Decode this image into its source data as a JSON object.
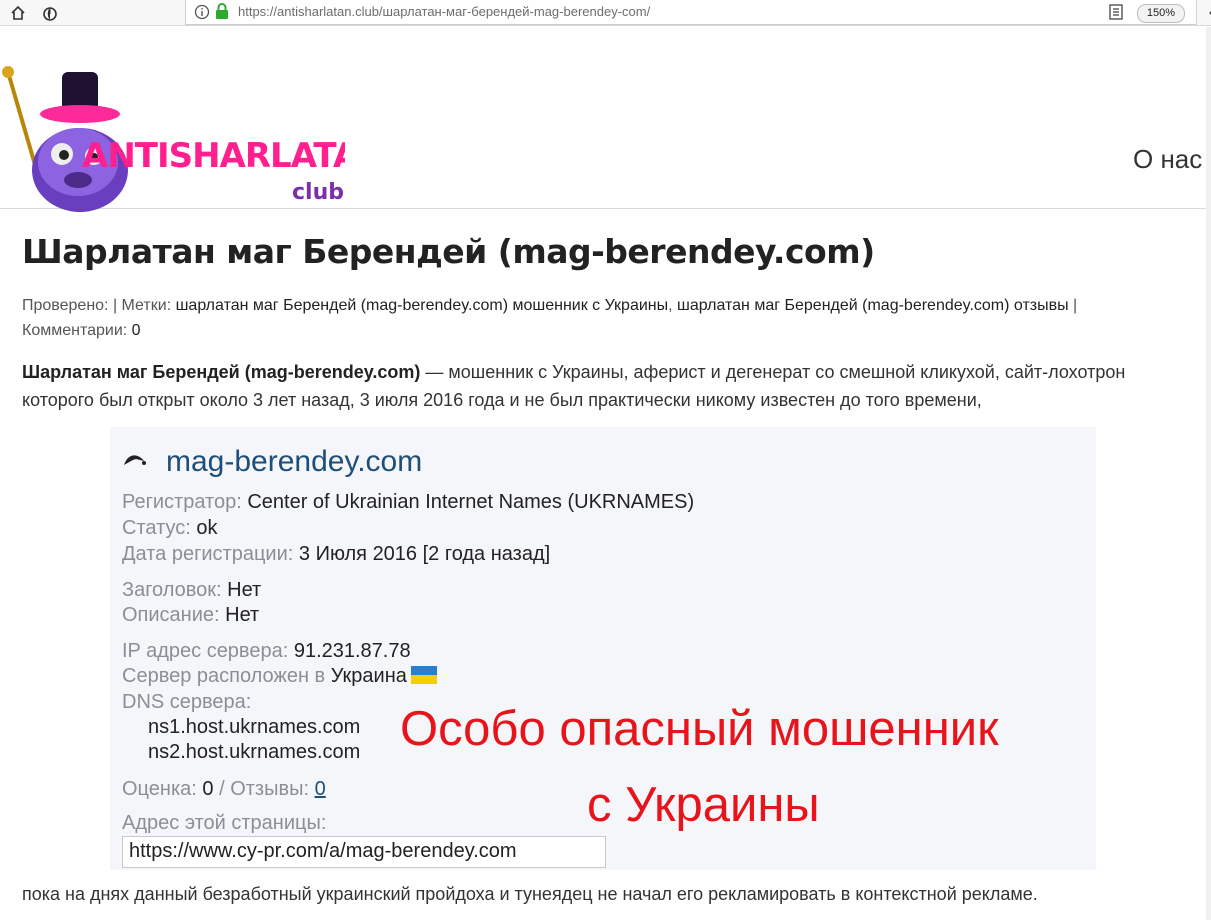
{
  "browser": {
    "url_host": "https://antisharlatan.club",
    "url_path": "/шарлатан-маг-берендей-mag-berendey-com/",
    "zoom": "150%"
  },
  "header": {
    "logo_text": "ANTISHARLATAN",
    "logo_sub": "club",
    "nav_about": "О нас"
  },
  "article": {
    "title": "Шарлатан маг Берендей (mag-berendey.com)",
    "meta": {
      "checked_label": "Проверено:",
      "tags_label": "Метки:",
      "tag1": "шарлатан маг Берендей (mag-berendey.com) мошенник с Украины",
      "tag2": "шарлатан маг Берендей (mag-berendey.com) отзывы",
      "comments_label": "Комментарии:",
      "comments_count": "0"
    },
    "intro_bold": "Шарлатан маг Берендей (mag-berendey.com)",
    "intro_rest": " — мошенник с Украины, аферист и дегенерат со смешной кликухой, сайт-лохотрон которого был открыт около 3 лет назад, 3 июля 2016 года и не был практически никому известен до того времени,",
    "outro": "пока на днях данный безработный украинский пройдоха и тунеядец не начал его рекламировать в контекстной рекламе."
  },
  "whois": {
    "domain": "mag-berendey.com",
    "registrar_label": "Регистратор:",
    "registrar": "Center of Ukrainian Internet Names (UKRNAMES)",
    "status_label": "Статус:",
    "status": "ok",
    "reg_date_label": "Дата регистрации:",
    "reg_date": "3 Июля 2016 [2 года назад]",
    "heading_label": "Заголовок:",
    "heading": "Нет",
    "description_label": "Описание:",
    "description": "Нет",
    "ip_label": "IP адрес сервера:",
    "ip": "91.231.87.78",
    "location_label": "Сервер расположен в",
    "location": "Украина",
    "dns_label": "DNS сервера:",
    "dns": [
      "ns1.host.ukrnames.com",
      "ns2.host.ukrnames.com"
    ],
    "rating_label": "Оценка:",
    "rating": "0",
    "reviews_label": "/ Отзывы:",
    "reviews": "0",
    "page_address_label": "Адрес этой страницы:",
    "page_address": "https://www.cy-pr.com/a/mag-berendey.com",
    "warning_line1": "Особо опасный мошенник",
    "warning_line2": "с Украины"
  },
  "colors": {
    "logo_pink": "#ff1f8e",
    "logo_purple": "#7b2fa8",
    "warning_red": "#e8141c",
    "domain_blue": "#1d4f7a"
  }
}
